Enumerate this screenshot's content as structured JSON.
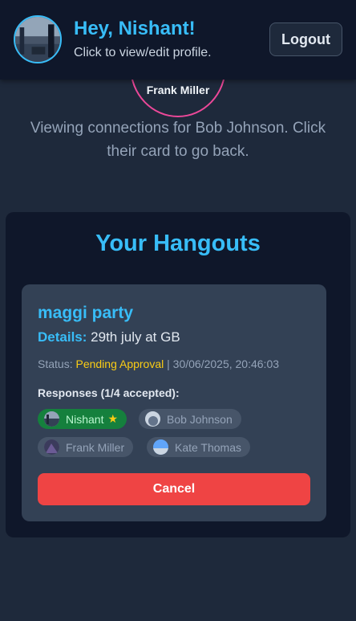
{
  "header": {
    "greeting": "Hey, Nishant!",
    "subtitle": "Click to view/edit profile.",
    "logout_label": "Logout"
  },
  "graph": {
    "focus_node_name": "Frank Miller",
    "viewing_text": "Viewing connections for Bob Johnson. Click their card to go back."
  },
  "hangouts": {
    "title": "Your Hangouts",
    "items": [
      {
        "title": "maggi party",
        "details_label": "Details:",
        "details_value": "29th july at GB",
        "status_label": "Status:",
        "status_value": "Pending Approval",
        "status_separator": "|",
        "timestamp": "30/06/2025, 20:46:03",
        "responses_label": "Responses (1/4 accepted):",
        "responses": [
          {
            "name": "Nishant",
            "accepted": true,
            "star": "★"
          },
          {
            "name": "Bob Johnson",
            "accepted": false
          },
          {
            "name": "Frank Miller",
            "accepted": false
          },
          {
            "name": "Kate Thomas",
            "accepted": false
          }
        ],
        "cancel_label": "Cancel"
      }
    ]
  },
  "colors": {
    "accent": "#38bdf8",
    "background": "#1e293b",
    "panel": "#0f172a",
    "card": "#334155",
    "pending": "#facc15",
    "accepted": "#15803d",
    "danger": "#ef4444",
    "focus_ring": "#ec4899"
  },
  "icons": {
    "profile_avatar": "avatar-photo-icon",
    "accepted_star": "star-icon"
  }
}
